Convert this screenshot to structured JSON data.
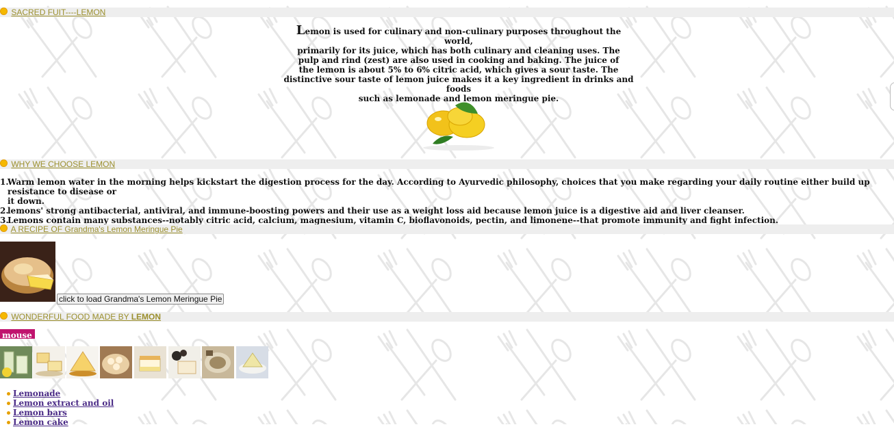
{
  "sections": {
    "sacred": "SACRED FUIT----LEMON",
    "why": "WHY WE CHOOSE LEMON",
    "recipe": "A RECIPE OF Grandma's Lemon Meringue Pie",
    "wonderful_prefix": "WONDERFUL FOOD MADE BY ",
    "wonderful_bold": "LEMON"
  },
  "intro": {
    "cap": "L",
    "line1": "emon is used for culinary and non-culinary purposes throughout the world,",
    "line2": "primarily for its juice, which has both culinary and cleaning uses. The",
    "line3": "pulp and rind (zest) are also used in cooking and baking. The juice of",
    "line4": "the lemon is about 5% to 6% citric acid, which gives a sour taste. The",
    "line5": "distinctive sour taste of lemon juice makes it a key ingredient in drinks and foods",
    "line6": "such as lemonade and lemon meringue pie."
  },
  "why_list": [
    {
      "num": "1.",
      "text": "Warm lemon water in the morning helps kickstart the digestion process for the day. According to Ayurvedic philosophy, choices that you make regarding your daily routine either build up resistance to disease or",
      "cont": "it down."
    },
    {
      "num": "2.",
      "text": "lemons' strong antibacterial, antiviral, and immune-boosting powers and their use as a weight loss aid because lemon juice is a digestive aid and liver cleanser."
    },
    {
      "num": "3.",
      "text": "Lemons contain many substances--notably citric acid, calcium, magnesium, vitamin C, bioflavonoids, pectin, and limonene--that promote immunity and fight infection."
    }
  ],
  "recipe": {
    "button_label": "click to load Grandma's Lemon Meringue Pie"
  },
  "mouse_tag": "mouse",
  "food_list": [
    "Lemonade",
    "Lemon extract and oil",
    "Lemon bars",
    "Lemon cake"
  ],
  "colors": {
    "bar_bg": "#eeeeee",
    "link": "#9b8f2d",
    "tag": "#c0146e",
    "list_link": "#4a2a86"
  }
}
